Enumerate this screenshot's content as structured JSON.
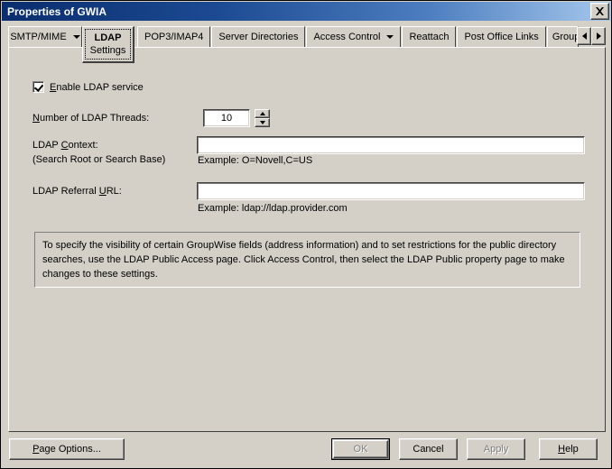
{
  "window": {
    "title": "Properties of GWIA",
    "close_label": "close-icon"
  },
  "tabs": {
    "items": [
      {
        "label": "SMTP/MIME",
        "has_dropdown": true,
        "selected": false
      },
      {
        "label": "POP3/IMAP4",
        "has_dropdown": false,
        "selected": false
      },
      {
        "label": "Server Directories",
        "has_dropdown": false,
        "selected": false
      },
      {
        "label": "Access Control",
        "has_dropdown": true,
        "selected": false
      },
      {
        "label": "Reattach",
        "has_dropdown": false,
        "selected": false
      },
      {
        "label": "Post Office Links",
        "has_dropdown": false,
        "selected": false
      },
      {
        "label": "Group",
        "has_dropdown": false,
        "selected": false,
        "truncated": true
      }
    ],
    "selected_tab": {
      "line1": "LDAP",
      "line2": "Settings"
    },
    "scroll_left": "scroll-left-icon",
    "scroll_right": "scroll-right-icon"
  },
  "form": {
    "enable_ldap": {
      "label_prefix": "",
      "label_accel": "E",
      "label_rest": "nable LDAP service",
      "checked": true
    },
    "threads": {
      "label_accel": "N",
      "label_rest": "umber of LDAP Threads:",
      "value": "10",
      "spin_up": "spinner-up-icon",
      "spin_down": "spinner-down-icon"
    },
    "ldap_context": {
      "label_pre": "LDAP ",
      "label_accel": "C",
      "label_rest": "ontext:",
      "sublabel": "(Search Root or Search Base)",
      "value": "",
      "example": "Example: O=Novell,C=US"
    },
    "ldap_referral": {
      "label_pre": "LDAP Referral ",
      "label_accel": "U",
      "label_rest": "RL:",
      "value": "",
      "example": "Example: ldap://ldap.provider.com"
    }
  },
  "info": {
    "text": "To specify the visibility of certain GroupWise fields (address information) and to set restrictions for the public directory searches, use the LDAP Public Access page. Click Access Control, then select the LDAP Public property page to make changes to these settings."
  },
  "buttons": {
    "page_options": {
      "accel": "P",
      "rest": "age Options...",
      "enabled": true
    },
    "ok": {
      "label": "OK",
      "enabled": false,
      "is_default": true
    },
    "cancel": {
      "label": "Cancel",
      "enabled": true
    },
    "apply": {
      "label": "Apply",
      "enabled": false
    },
    "help": {
      "accel": "H",
      "rest": "elp",
      "enabled": true
    }
  }
}
